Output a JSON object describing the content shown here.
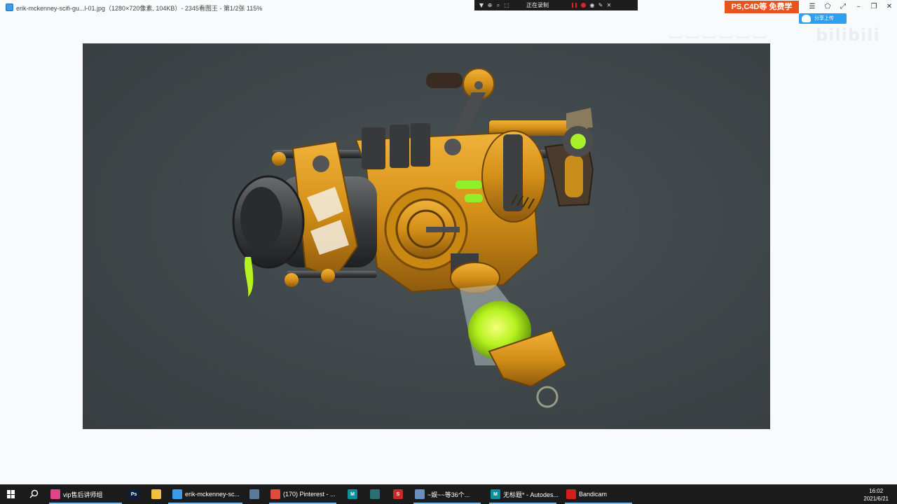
{
  "window": {
    "title": "erik-mckenney-scifi-gu...l-01.jpg（1280×720像素, 104KB）- 2345看图王 - 第1/2张 115%"
  },
  "recorder": {
    "status": "正在录制"
  },
  "promo": {
    "label": "PS,C4D等 免费学"
  },
  "share": {
    "label": "分享上传"
  },
  "watermark": {
    "text": "bilibili"
  },
  "icons": {
    "app": "image-viewer-icon",
    "window_menu": "menu-icon",
    "window_skin": "skin-icon",
    "window_fullscreen": "fullscreen-icon",
    "window_minimize": "minimize-icon",
    "window_restore": "restore-icon",
    "window_close": "close-icon"
  },
  "colors": {
    "promo": "#e8541e",
    "share": "#2ea0f0",
    "image_bg": "#3e4548",
    "gun_body": "#d79a1c",
    "glow": "#b6f21f",
    "taskbar": "#1b1b1c"
  },
  "taskbar": {
    "items": [
      {
        "label": "vip售后讲师组",
        "icon": "chat-icon",
        "color": "#e0458a"
      },
      {
        "label": "",
        "icon": "photoshop-icon",
        "color": "#0a1f3f",
        "glyph": "Ps"
      },
      {
        "label": "",
        "icon": "folder-icon",
        "color": "#f0c040"
      },
      {
        "label": "erik-mckenney-sc...",
        "icon": "image-viewer-icon",
        "color": "#3b9be8"
      },
      {
        "label": "",
        "icon": "window-icon",
        "color": "#5b7a99"
      },
      {
        "label": "(170) Pinterest - ...",
        "icon": "chrome-icon",
        "color": "#dd4b39"
      },
      {
        "label": "",
        "icon": "maya-icon",
        "color": "#0d8f9a",
        "glyph": "M"
      },
      {
        "label": "",
        "icon": "arnold-icon",
        "color": "#2a6f74"
      },
      {
        "label": "",
        "icon": "substance-icon",
        "color": "#c42b2b",
        "glyph": "S"
      },
      {
        "label": "~娱~~等36个...",
        "icon": "globe-icon",
        "color": "#6a8fbf"
      },
      {
        "label": "无标题* - Autodes...",
        "icon": "maya-icon",
        "color": "#0d8f9a",
        "glyph": "M"
      },
      {
        "label": "Bandicam",
        "icon": "record-icon",
        "color": "#d11f1f"
      }
    ],
    "time": "16:02",
    "date": "2021/6/21"
  }
}
